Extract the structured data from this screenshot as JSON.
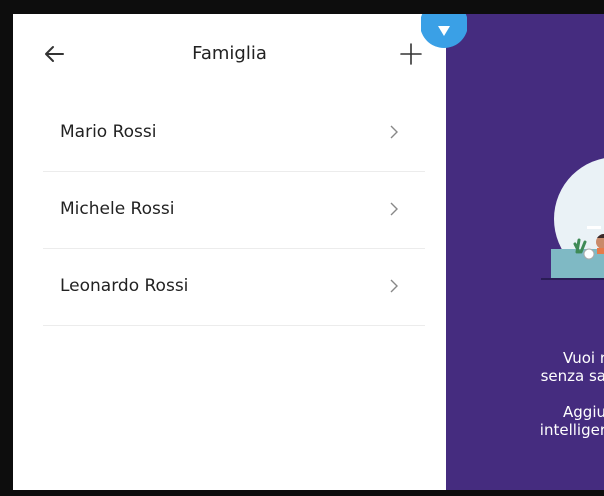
{
  "header": {
    "title": "Famiglia",
    "back_icon": "arrow-left-icon",
    "add_icon": "plus-icon"
  },
  "members": [
    {
      "name": "Mario Rossi"
    },
    {
      "name": "Michele Rossi"
    },
    {
      "name": "Leonardo Rossi"
    }
  ],
  "promo": {
    "line1": "Vuoi r",
    "line2": "senza sa",
    "line3": "Aggiu",
    "line4": "intelliger"
  },
  "colors": {
    "accent_purple": "#452c7f",
    "badge_blue": "#3aa0e6",
    "divider": "#ececec"
  }
}
